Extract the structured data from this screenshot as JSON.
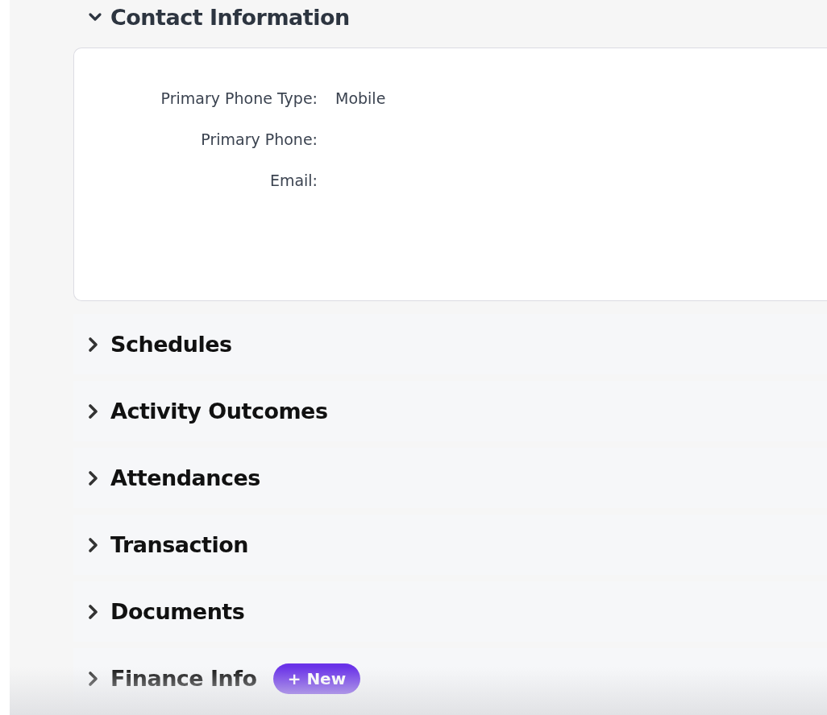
{
  "sections": [
    {
      "title": "Contact Information",
      "expanded": true,
      "fields": [
        {
          "label": "Primary Phone Type:",
          "value": "Mobile"
        },
        {
          "label": "Primary Phone:"
        },
        {
          "label": "Email:"
        }
      ]
    },
    {
      "title": "Schedules",
      "expanded": false
    },
    {
      "title": "Activity Outcomes",
      "expanded": false
    },
    {
      "title": "Attendances",
      "expanded": false
    },
    {
      "title": "Transaction",
      "expanded": false
    },
    {
      "title": "Documents",
      "expanded": false
    },
    {
      "title": "Finance Info",
      "expanded": false,
      "badge": "+ New"
    }
  ]
}
